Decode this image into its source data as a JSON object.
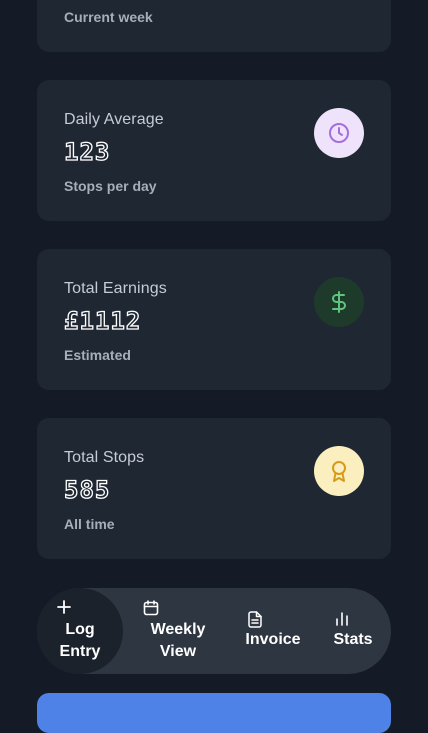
{
  "cards": [
    {
      "sub": "Current week"
    },
    {
      "title": "Daily Average",
      "value": "123",
      "sub": "Stops per day",
      "icon": "clock-icon",
      "icon_bg": "#efe3fb",
      "icon_color": "#a56ee0"
    },
    {
      "title": "Total Earnings",
      "value": "£1112",
      "sub": "Estimated",
      "icon": "dollar-icon",
      "icon_bg": "#1e3a2b",
      "icon_color": "#5ec47e"
    },
    {
      "title": "Total Stops",
      "value": "585",
      "sub": "All time",
      "icon": "award-icon",
      "icon_bg": "#fbefc0",
      "icon_color": "#d79a1b"
    }
  ],
  "nav": {
    "items": [
      {
        "label": "Log Entry",
        "icon": "plus-icon",
        "active": true
      },
      {
        "label": "Weekly View",
        "icon": "calendar-icon",
        "active": false
      },
      {
        "label": "Invoice",
        "icon": "document-icon",
        "active": false
      },
      {
        "label": "Stats",
        "icon": "bar-chart-icon",
        "active": false
      }
    ]
  },
  "colors": {
    "background": "#141b27",
    "card": "#1f2733",
    "nav": "#2e3642",
    "primary_button": "#4f82e6"
  }
}
